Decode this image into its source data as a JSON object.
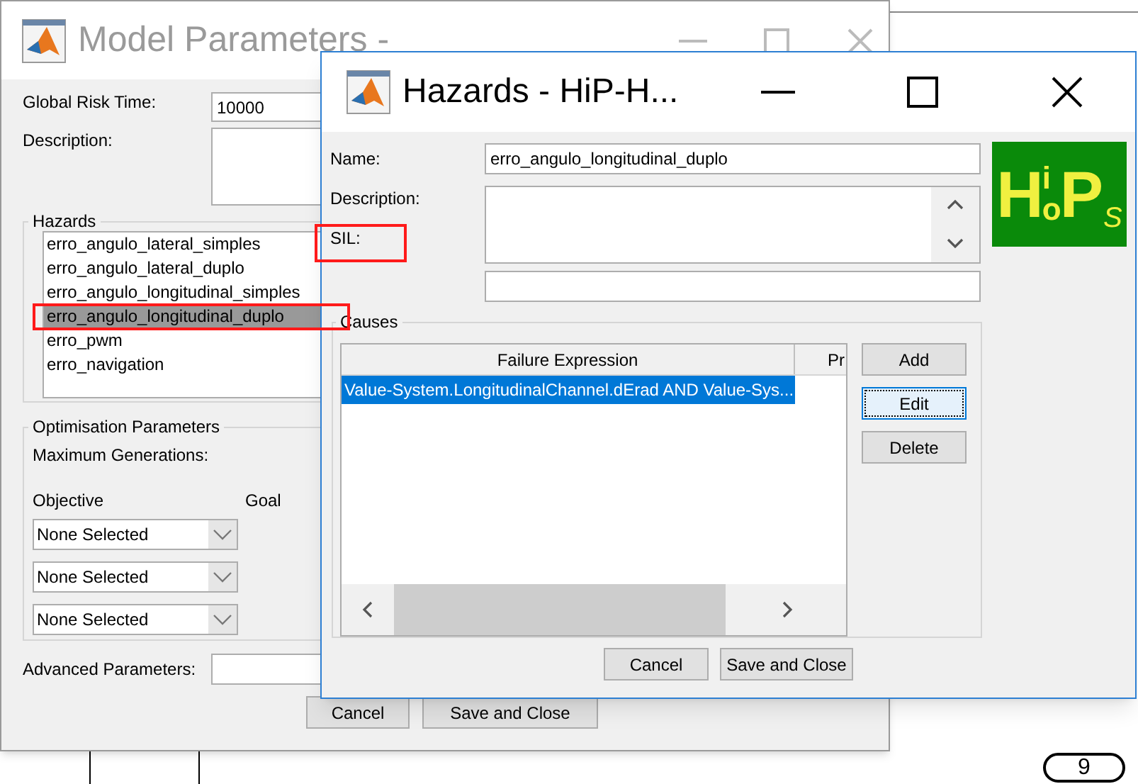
{
  "background": {
    "badge": "9"
  },
  "main_window": {
    "title": "Model Parameters -",
    "global_risk_time": {
      "label": "Global Risk Time:",
      "value": "10000"
    },
    "description": {
      "label": "Description:"
    },
    "hazards": {
      "title": "Hazards",
      "items": [
        {
          "label": "erro_angulo_lateral_simples",
          "selected": false
        },
        {
          "label": "erro_angulo_lateral_duplo",
          "selected": false
        },
        {
          "label": "erro_angulo_longitudinal_simples",
          "selected": false
        },
        {
          "label": "erro_angulo_longitudinal_duplo",
          "selected": true
        },
        {
          "label": "erro_pwm",
          "selected": false
        },
        {
          "label": "erro_navigation",
          "selected": false
        }
      ]
    },
    "optimisation": {
      "title": "Optimisation Parameters",
      "max_generations_label": "Maximum Generations:",
      "objective_header": "Objective",
      "goal_header": "Goal",
      "objectives": [
        {
          "value": "None Selected"
        },
        {
          "value": "None Selected"
        },
        {
          "value": "None Selected"
        }
      ]
    },
    "advanced": {
      "label": "Advanced Parameters:"
    },
    "buttons": [
      "Cancel",
      "Save and Close"
    ]
  },
  "hazard_dialog": {
    "title": "Hazards - HiP-H...",
    "name": {
      "label": "Name:",
      "value": "erro_angulo_longitudinal_duplo"
    },
    "description_label": "Description:",
    "sil_label": "SIL:",
    "logo": {
      "big_left": "H",
      "small_top": "i",
      "small_bottom": "o",
      "big_right": "P",
      "tail": "S"
    },
    "causes": {
      "title": "Causes",
      "columns": [
        "Failure Expression",
        "Pr"
      ],
      "rows": [
        {
          "expression": "Value-System.LongitudinalChannel.dErad AND Value-Sys...",
          "selected": true
        }
      ]
    },
    "side_buttons": [
      {
        "label": "Add",
        "focused": false
      },
      {
        "label": "Edit",
        "focused": true
      },
      {
        "label": "Delete",
        "focused": false
      }
    ],
    "buttons": [
      "Cancel",
      "Save and Close"
    ]
  }
}
